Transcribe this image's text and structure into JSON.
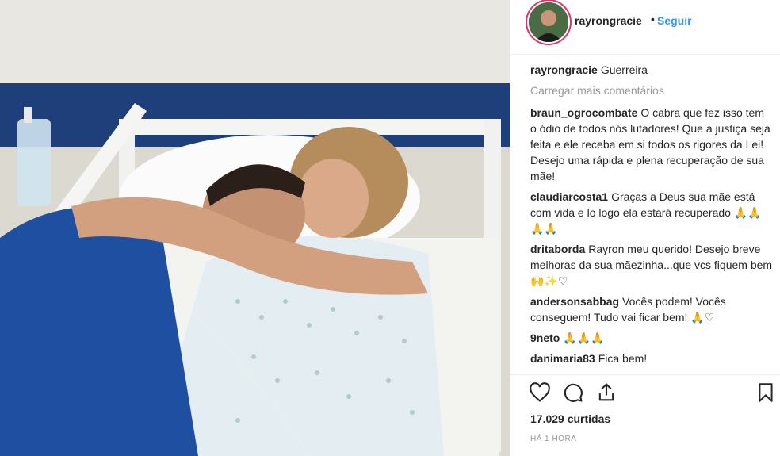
{
  "post": {
    "username": "rayrongracie",
    "dot": "•",
    "follow_label": "Seguir",
    "caption_user": "rayrongracie",
    "caption_text": "Guerreira",
    "load_more": "Carregar mais comentários",
    "likes": "17.029 curtidas",
    "time": "HÁ 1 HORA"
  },
  "comments": [
    {
      "user": "braun_ogrocombate",
      "text": "O cabra que fez isso tem o ódio de todos nós lutadores! Que a justiça seja feita e ele receba em si todos os rigores da Lei! Desejo uma rápida e plena recuperação de sua mãe!"
    },
    {
      "user": "claudiarcosta1",
      "text": "Graças a Deus sua mãe está com vida e lo logo ela estará recuperado 🙏🙏🙏🙏"
    },
    {
      "user": "dritaborda",
      "text": "Rayron meu querido! Desejo breve melhoras da sua mãezinha...que vcs fiquem bem 🙌✨♡"
    },
    {
      "user": "andersonsabbag",
      "text": "Vocês podem! Vocês conseguem! Tudo vai ficar bem! 🙏♡"
    },
    {
      "user": "9neto",
      "text": "🙏🙏🙏"
    },
    {
      "user": "danimaria83",
      "text": "Fica bem!"
    }
  ],
  "icons": {
    "like": "heart-icon",
    "comment": "comment-icon",
    "share": "share-icon",
    "save": "bookmark-icon"
  },
  "colors": {
    "follow": "#3897f0",
    "muted": "#999999",
    "text": "#262626"
  }
}
